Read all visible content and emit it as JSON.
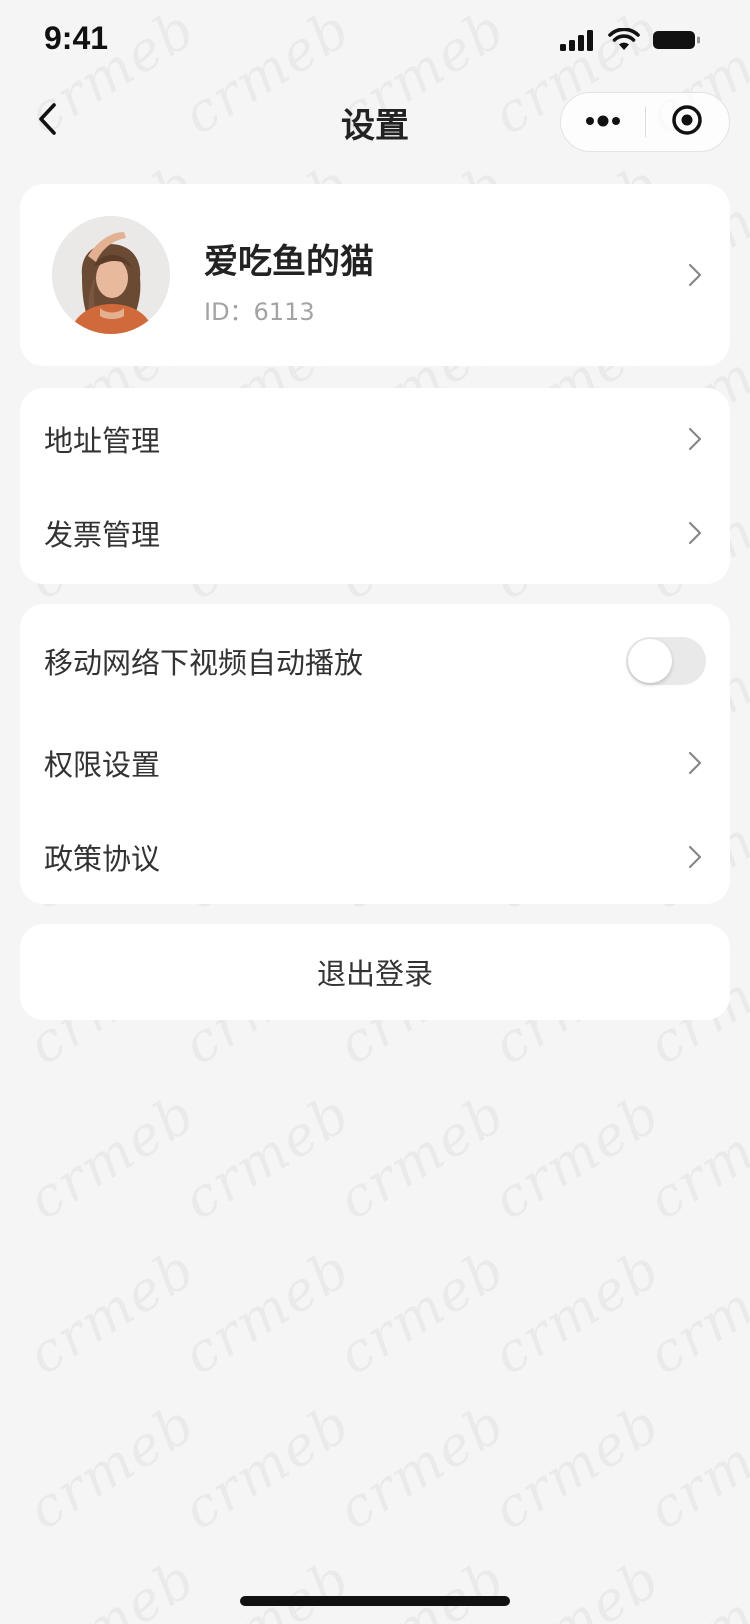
{
  "status_bar": {
    "time": "9:41",
    "icons": [
      "signal-icon",
      "wifi-icon",
      "battery-icon"
    ]
  },
  "nav": {
    "title": "设置",
    "back_icon": "chevron-left-icon",
    "capsule_icons": [
      "more-dots-icon",
      "target-icon"
    ]
  },
  "profile": {
    "name": "爱吃鱼的猫",
    "id_text": "ID：6113"
  },
  "menu_group_1": [
    {
      "label": "地址管理"
    },
    {
      "label": "发票管理"
    }
  ],
  "menu_group_2": {
    "toggle_row": {
      "label": "移动网络下视频自动播放",
      "enabled": false
    },
    "items": [
      {
        "label": "权限设置"
      },
      {
        "label": "政策协议"
      }
    ]
  },
  "logout": {
    "label": "退出登录"
  },
  "watermark": {
    "text": "crmeb"
  },
  "colors": {
    "background": "#f5f5f5",
    "card": "#ffffff",
    "text_primary": "#333333",
    "text_secondary": "#a3a3a3",
    "toggle_off": "#e9e9ea"
  }
}
